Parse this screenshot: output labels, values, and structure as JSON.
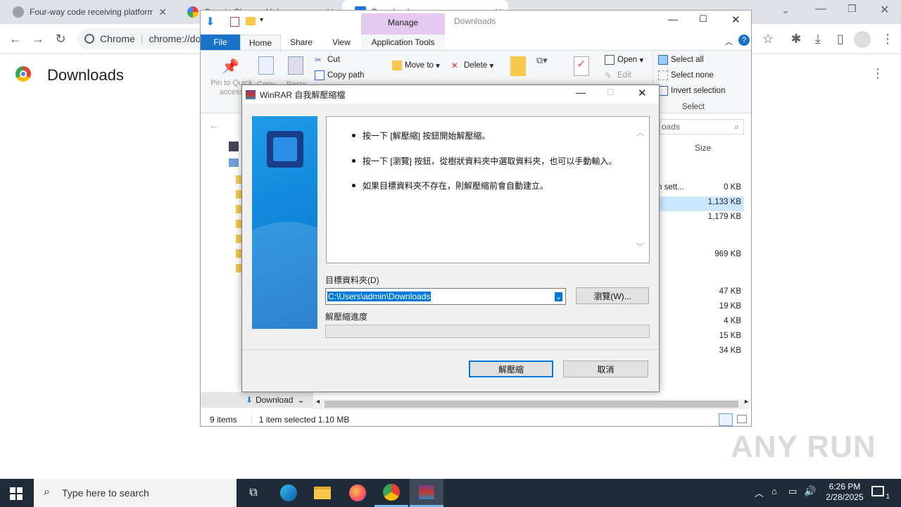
{
  "chrome": {
    "tabs": [
      {
        "title": "Four-way code receiving platform",
        "active": false
      },
      {
        "title": "Google Chrome Help",
        "active": false
      },
      {
        "title": "Downloads",
        "active": true
      }
    ],
    "omnibox_site": "Chrome",
    "omnibox_url": "chrome://do",
    "page_title": "Downloads"
  },
  "explorer": {
    "title": "Downloads",
    "context_tab": "Manage",
    "context_subtab": "Application Tools",
    "tabs": [
      "File",
      "Home",
      "Share",
      "View"
    ],
    "ribbon": {
      "pin": "Pin to Quick access",
      "copy": "Copy",
      "paste": "Paste",
      "cut": "Cut",
      "copy_path": "Copy path",
      "move_to": "Move to",
      "delete": "Delete",
      "copy_to": "Copy to",
      "rename": "Rename",
      "new_folder": "New",
      "properties": "Properties",
      "open": "Open",
      "edit": "Edit",
      "select_all": "Select all",
      "select_none": "Select none",
      "invert_selection": "Invert selection",
      "select_group": "Select"
    },
    "search_placeholder": "oads",
    "column_size": "Size",
    "file_partial_name": "n sett...",
    "sizes": [
      "0 KB",
      "1,133 KB",
      "1,179 KB",
      "969 KB",
      "47 KB",
      "19 KB",
      "4 KB",
      "15 KB",
      "34 KB"
    ],
    "nav_bottom": "Download",
    "status_items": "9 items",
    "status_selected": "1 item selected  1.10 MB"
  },
  "winrar": {
    "title": "WinRAR 自我解壓縮檔",
    "instructions": [
      "按一下 [解壓縮] 按鈕開始解壓縮。",
      "按一下 [瀏覽] 按鈕，從樹狀資料夾中選取資料夾，也可以手動輸入。",
      "如果目標資料夾不存在，則解壓縮前會自動建立。"
    ],
    "dest_label": "目標資料夾(D)",
    "dest_value": "C:\\Users\\admin\\Downloads",
    "browse_button": "瀏覽(W)...",
    "progress_label": "解壓縮進度",
    "progress_value": 0,
    "extract_button": "解壓縮",
    "cancel_button": "取消"
  },
  "taskbar": {
    "search_placeholder": "Type here to search",
    "time": "6:26 PM",
    "date": "2/28/2025",
    "notification_count": "1"
  },
  "watermark": "ANY RUN"
}
